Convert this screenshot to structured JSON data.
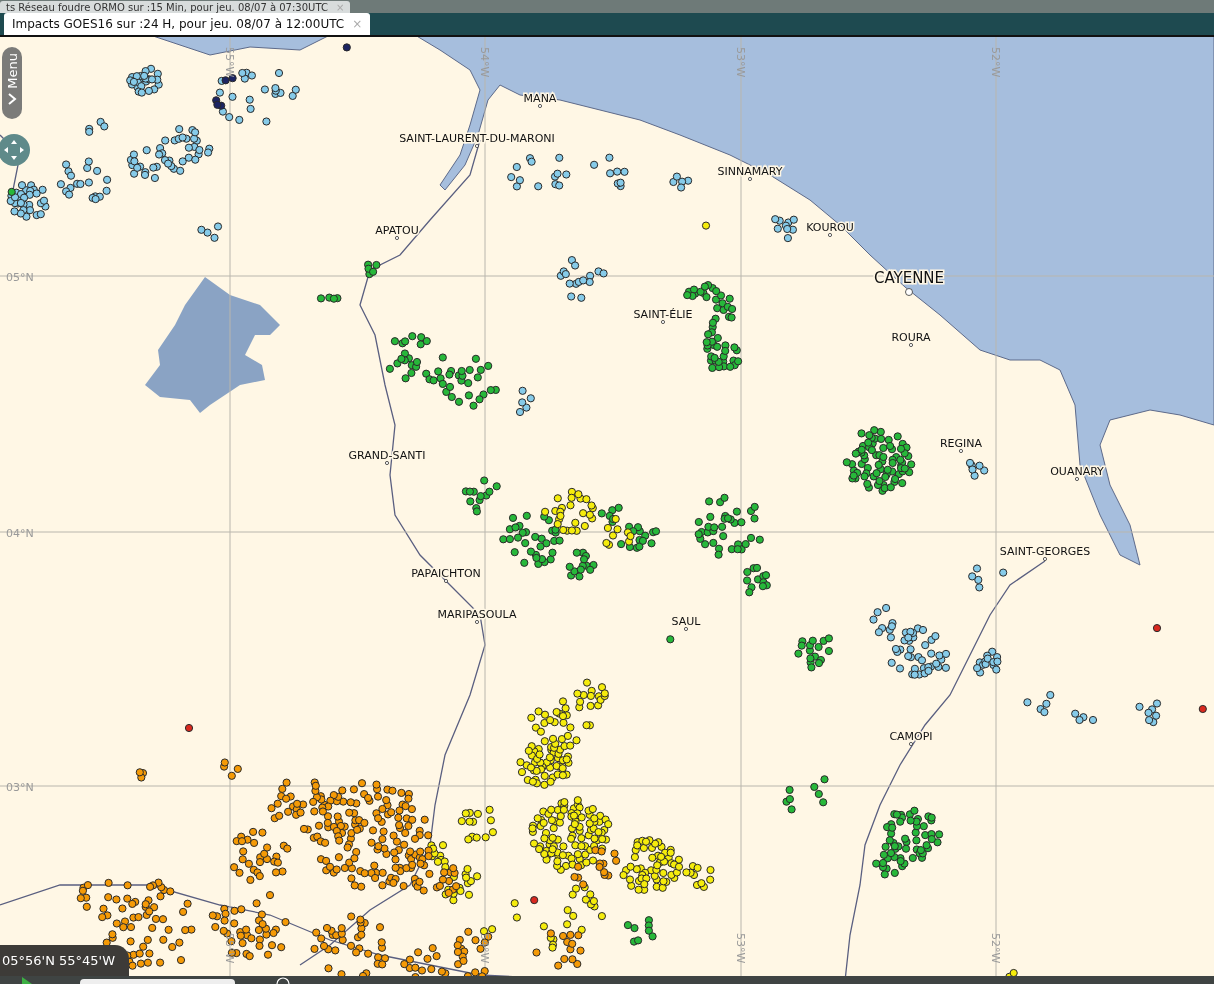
{
  "tabs": [
    {
      "label": "ts Réseau foudre ORMO sur :15 Min, pour jeu. 08/07 à 07:30UTC",
      "close": "×",
      "selected": false
    },
    {
      "label": "Impacts GOES16 sur :24 H,  pour jeu. 08/07 à 12:00UTC",
      "close": "×",
      "selected": true
    }
  ],
  "menu_handle": {
    "label": "Menu"
  },
  "map": {
    "places": [
      {
        "name": "MANA",
        "kind": "town"
      },
      {
        "name": "SAINT-LAURENT-DU-MARONI",
        "kind": "town"
      },
      {
        "name": "SINNAMARY",
        "kind": "town"
      },
      {
        "name": "APATOU",
        "kind": "town"
      },
      {
        "name": "KOUROU",
        "kind": "town"
      },
      {
        "name": "CAYENNE",
        "kind": "prefecture"
      },
      {
        "name": "SAINT-ÉLIE",
        "kind": "town"
      },
      {
        "name": "ROURA",
        "kind": "town"
      },
      {
        "name": "GRAND-SANTI",
        "kind": "town"
      },
      {
        "name": "REGINA",
        "kind": "town"
      },
      {
        "name": "OUANARY",
        "kind": "town"
      },
      {
        "name": "SAINT-GEORGES",
        "kind": "town"
      },
      {
        "name": "PAPAICHTON",
        "kind": "town"
      },
      {
        "name": "MARIPASOULA",
        "kind": "town"
      },
      {
        "name": "SAUL",
        "kind": "town"
      },
      {
        "name": "CAMOPI",
        "kind": "town"
      }
    ],
    "lat_labels": [
      "05°N",
      "04°N",
      "03°N"
    ],
    "lon_labels_top": [
      "55°W",
      "54°W",
      "53°W",
      "52°W"
    ],
    "lon_labels_bottom": [
      "55°W",
      "54°W",
      "53°W",
      "52°W"
    ]
  },
  "cursor_position": "05°56'N 55°45'W"
}
